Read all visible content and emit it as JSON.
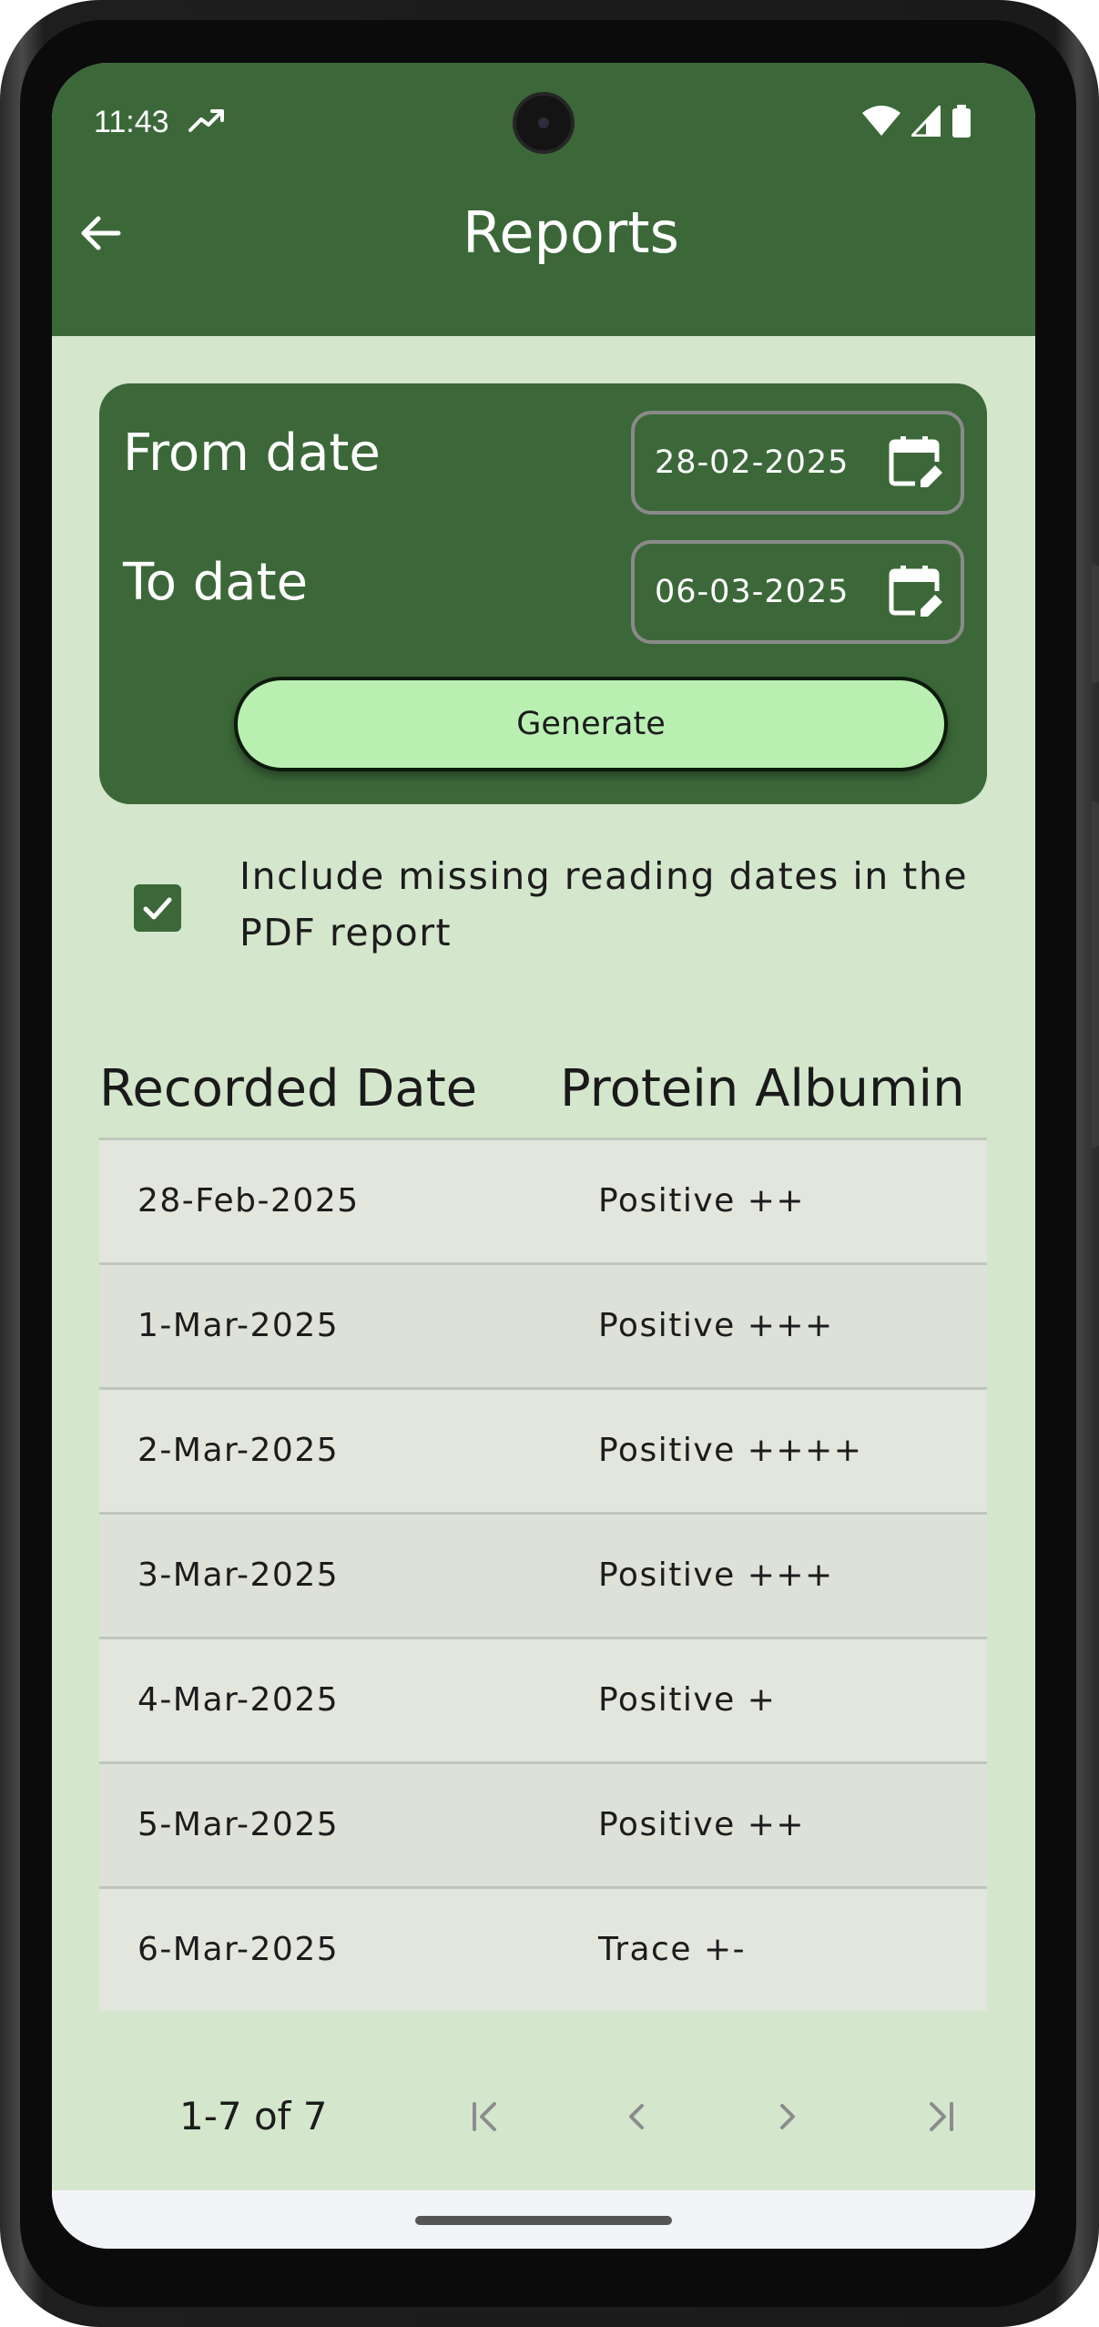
{
  "status_bar": {
    "time": "11:43"
  },
  "app_bar": {
    "title": "Reports"
  },
  "date_card": {
    "from_label": "From date",
    "from_value": "28-02-2025",
    "to_label": "To date",
    "to_value": "06-03-2025",
    "generate_label": "Generate"
  },
  "options": {
    "include_missing_label": "Include missing reading dates in the PDF report",
    "include_missing_checked": true
  },
  "table": {
    "headers": [
      "Recorded Date",
      "Protein Albumin"
    ],
    "rows": [
      {
        "date": "28-Feb-2025",
        "value": "Positive ++"
      },
      {
        "date": "1-Mar-2025",
        "value": "Positive +++"
      },
      {
        "date": "2-Mar-2025",
        "value": "Positive ++++"
      },
      {
        "date": "3-Mar-2025",
        "value": "Positive +++"
      },
      {
        "date": "4-Mar-2025",
        "value": "Positive +"
      },
      {
        "date": "5-Mar-2025",
        "value": "Positive ++"
      },
      {
        "date": "6-Mar-2025",
        "value": "Trace +-"
      }
    ]
  },
  "pagination": {
    "range_label": "1-7 of 7"
  },
  "colors": {
    "primary": "#3c6839",
    "background": "#d4e6cc",
    "button": "#b9f0b2"
  },
  "icons": {
    "back": "arrow-left-icon",
    "calendar": "calendar-edit-icon",
    "first": "first-page-icon",
    "prev": "chevron-left-icon",
    "next": "chevron-right-icon",
    "last": "last-page-icon"
  }
}
